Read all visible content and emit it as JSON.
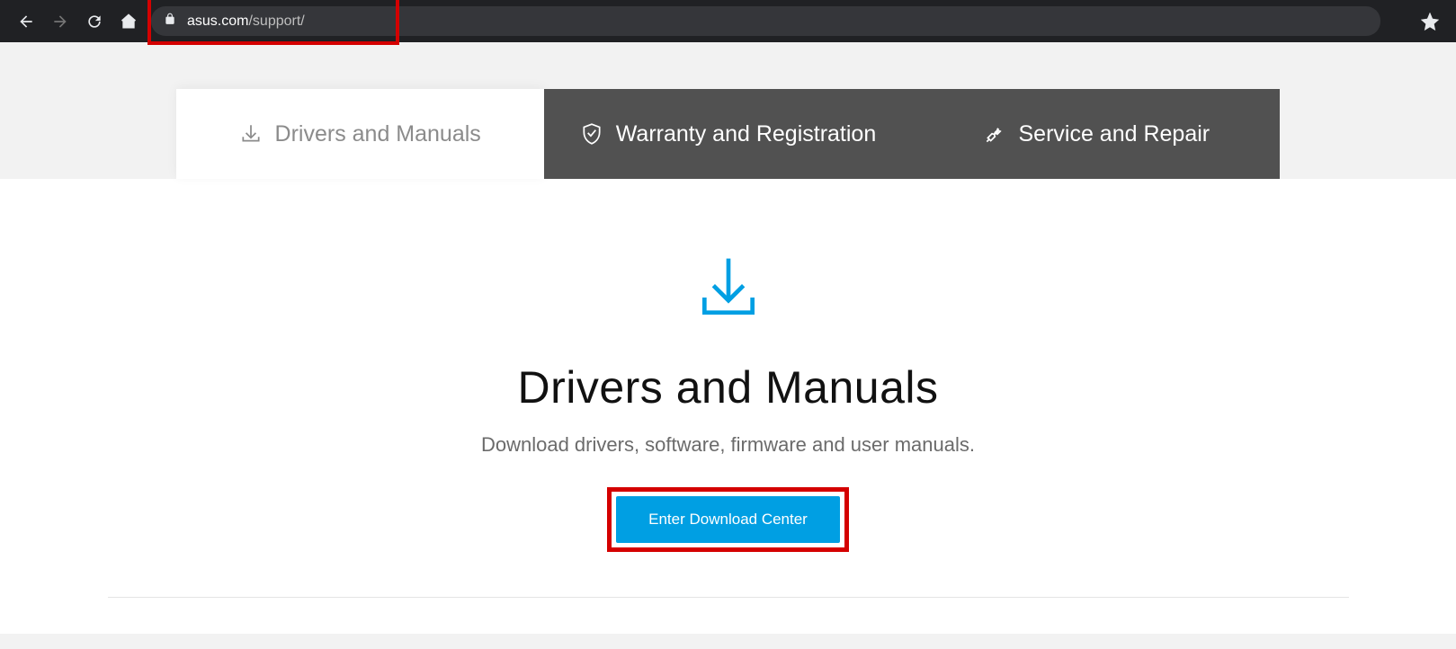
{
  "browser": {
    "url_domain": "asus.com",
    "url_path": "/support/"
  },
  "tabs": [
    {
      "label": "Drivers and Manuals"
    },
    {
      "label": "Warranty and Registration"
    },
    {
      "label": "Service and Repair"
    }
  ],
  "main": {
    "heading": "Drivers and Manuals",
    "subheading": "Download drivers, software, firmware and user manuals.",
    "cta_label": "Enter Download Center"
  }
}
